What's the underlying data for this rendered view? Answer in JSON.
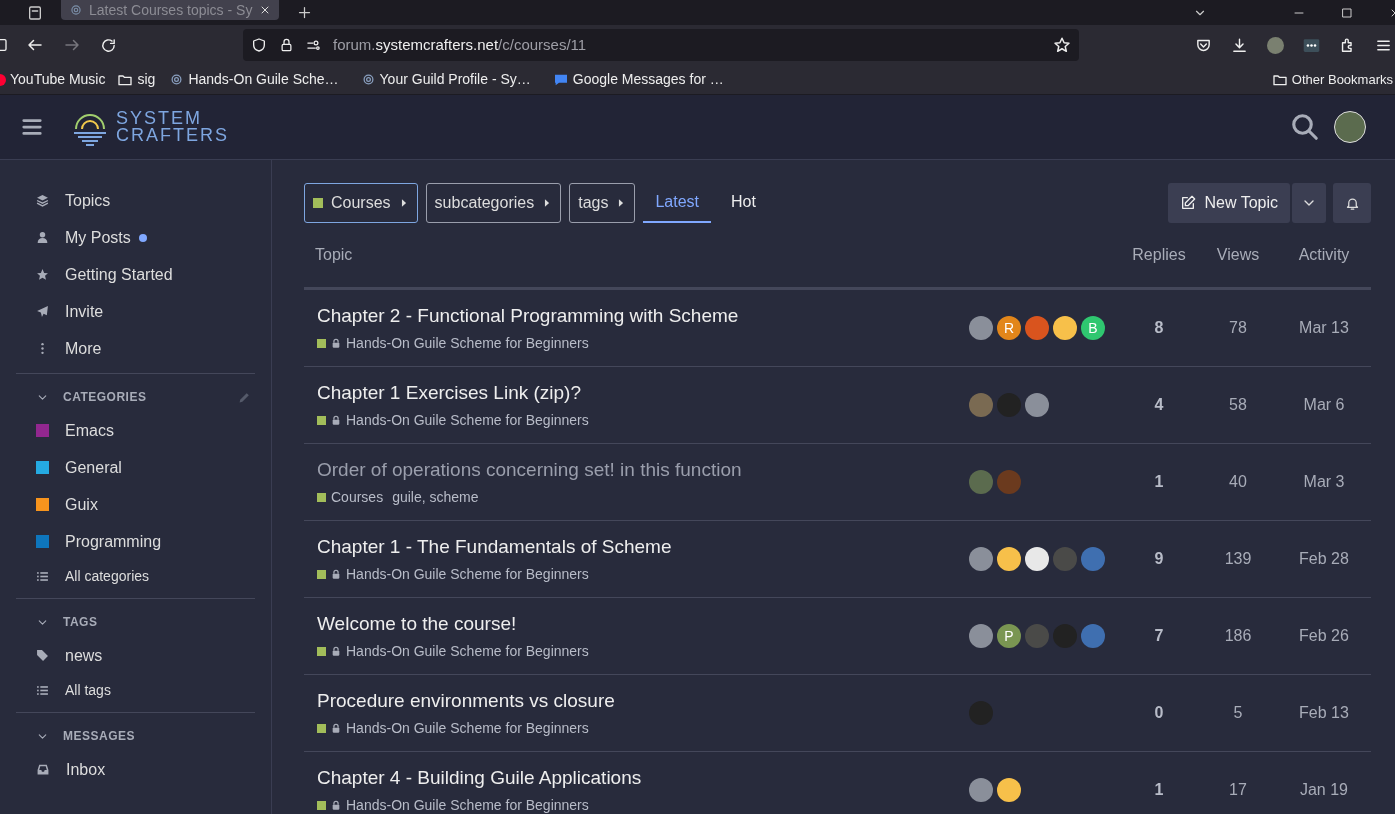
{
  "browser": {
    "tab_title": "Latest Courses topics - Sy",
    "url_host": "forum.",
    "url_domain": "systemcrafters.net",
    "url_path": "/c/courses/11",
    "bookmarks": [
      {
        "kind": "app",
        "label": "YouTube Music"
      },
      {
        "kind": "folder",
        "label": "sig"
      },
      {
        "kind": "site",
        "label": "Hands-On Guile Sche…"
      },
      {
        "kind": "site",
        "label": "Your Guild Profile - Sy…"
      },
      {
        "kind": "chat",
        "label": "Google Messages for …"
      }
    ],
    "other_bookmarks": "Other Bookmarks"
  },
  "header": {
    "logo_line1": "SYSTEM",
    "logo_line2": "CRAFTERS"
  },
  "sidebar": {
    "items": [
      {
        "label": "Topics",
        "unread": false
      },
      {
        "label": "My Posts",
        "unread": true
      },
      {
        "label": "Getting Started",
        "unread": false
      },
      {
        "label": "Invite",
        "unread": false
      },
      {
        "label": "More",
        "unread": false
      }
    ],
    "sections": [
      {
        "title": "CATEGORIES",
        "editable": true,
        "items": [
          {
            "kind": "category",
            "label": "Emacs",
            "color": "#92278f"
          },
          {
            "kind": "category",
            "label": "General",
            "color": "#25aae2"
          },
          {
            "kind": "category",
            "label": "Guix",
            "color": "#f7941d"
          },
          {
            "kind": "category",
            "label": "Programming",
            "color": "#0e76bd"
          },
          {
            "kind": "all",
            "label": "All categories"
          }
        ]
      },
      {
        "title": "TAGS",
        "editable": false,
        "items": [
          {
            "kind": "tag",
            "label": "news"
          },
          {
            "kind": "all",
            "label": "All tags"
          }
        ]
      },
      {
        "title": "MESSAGES",
        "editable": false,
        "items": [
          {
            "kind": "inbox",
            "label": "Inbox"
          }
        ]
      }
    ]
  },
  "filters": [
    {
      "label": "Courses",
      "color": "#a2bd5a",
      "selected": true
    },
    {
      "label": "subcategories",
      "selected": false
    },
    {
      "label": "tags",
      "selected": false
    }
  ],
  "nav_tabs": [
    {
      "label": "Latest",
      "selected": true
    },
    {
      "label": "Hot",
      "selected": false
    }
  ],
  "new_topic": "New Topic",
  "table": {
    "columns": [
      "Topic",
      "Replies",
      "Views",
      "Activity"
    ],
    "rows": [
      {
        "title": "Chapter 2 - Functional Programming with Scheme",
        "read": false,
        "locked": true,
        "category": "Hands-On Guile Scheme for Beginners",
        "color": "#a2bd5a",
        "avatars": [
          {
            "color": "#8a8f9a"
          },
          {
            "letter": "R",
            "color": "#e2861a"
          },
          {
            "color": "#d9541e"
          },
          {
            "color": "#f7c04a"
          },
          {
            "letter": "B",
            "color": "#2fc770"
          }
        ],
        "replies": "8",
        "views": "78",
        "activity": "Mar 13"
      },
      {
        "title": "Chapter 1 Exercises Link (zip)?",
        "read": false,
        "locked": true,
        "category": "Hands-On Guile Scheme for Beginners",
        "color": "#a2bd5a",
        "avatars": [
          {
            "color": "#7a6a52"
          },
          {
            "color": "#222222"
          },
          {
            "color": "#8a8f9a"
          }
        ],
        "replies": "4",
        "views": "58",
        "activity": "Mar 6"
      },
      {
        "title": "Order of operations concerning set! in this function",
        "read": true,
        "locked": false,
        "category": "Courses",
        "color": "#a2bd5a",
        "tags": "guile, scheme",
        "avatars": [
          {
            "color": "#5b6b4e"
          },
          {
            "color": "#6b3a1e"
          }
        ],
        "replies": "1",
        "views": "40",
        "activity": "Mar 3"
      },
      {
        "title": "Chapter 1 - The Fundamentals of Scheme",
        "read": false,
        "locked": true,
        "category": "Hands-On Guile Scheme for Beginners",
        "color": "#a2bd5a",
        "avatars": [
          {
            "color": "#8a8f9a"
          },
          {
            "color": "#f7c04a"
          },
          {
            "color": "#e8e8e8"
          },
          {
            "color": "#4a4a48"
          },
          {
            "color": "#3f6fb0"
          }
        ],
        "replies": "9",
        "views": "139",
        "activity": "Feb 28"
      },
      {
        "title": "Welcome to the course!",
        "read": false,
        "locked": true,
        "category": "Hands-On Guile Scheme for Beginners",
        "color": "#a2bd5a",
        "avatars": [
          {
            "color": "#8a8f9a"
          },
          {
            "letter": "P",
            "color": "#7a9652"
          },
          {
            "color": "#4a4a48"
          },
          {
            "color": "#222222"
          },
          {
            "color": "#3f6fb0"
          }
        ],
        "replies": "7",
        "views": "186",
        "activity": "Feb 26"
      },
      {
        "title": "Procedure environments vs closure",
        "read": false,
        "locked": true,
        "category": "Hands-On Guile Scheme for Beginners",
        "color": "#a2bd5a",
        "avatars": [
          {
            "color": "#222222"
          }
        ],
        "replies": "0",
        "views": "5",
        "activity": "Feb 13"
      },
      {
        "title": "Chapter 4 - Building Guile Applications",
        "read": false,
        "locked": true,
        "category": "Hands-On Guile Scheme for Beginners",
        "color": "#a2bd5a",
        "avatars": [
          {
            "color": "#8a8f9a"
          },
          {
            "color": "#f7c04a"
          }
        ],
        "replies": "1",
        "views": "17",
        "activity": "Jan 19"
      }
    ]
  }
}
